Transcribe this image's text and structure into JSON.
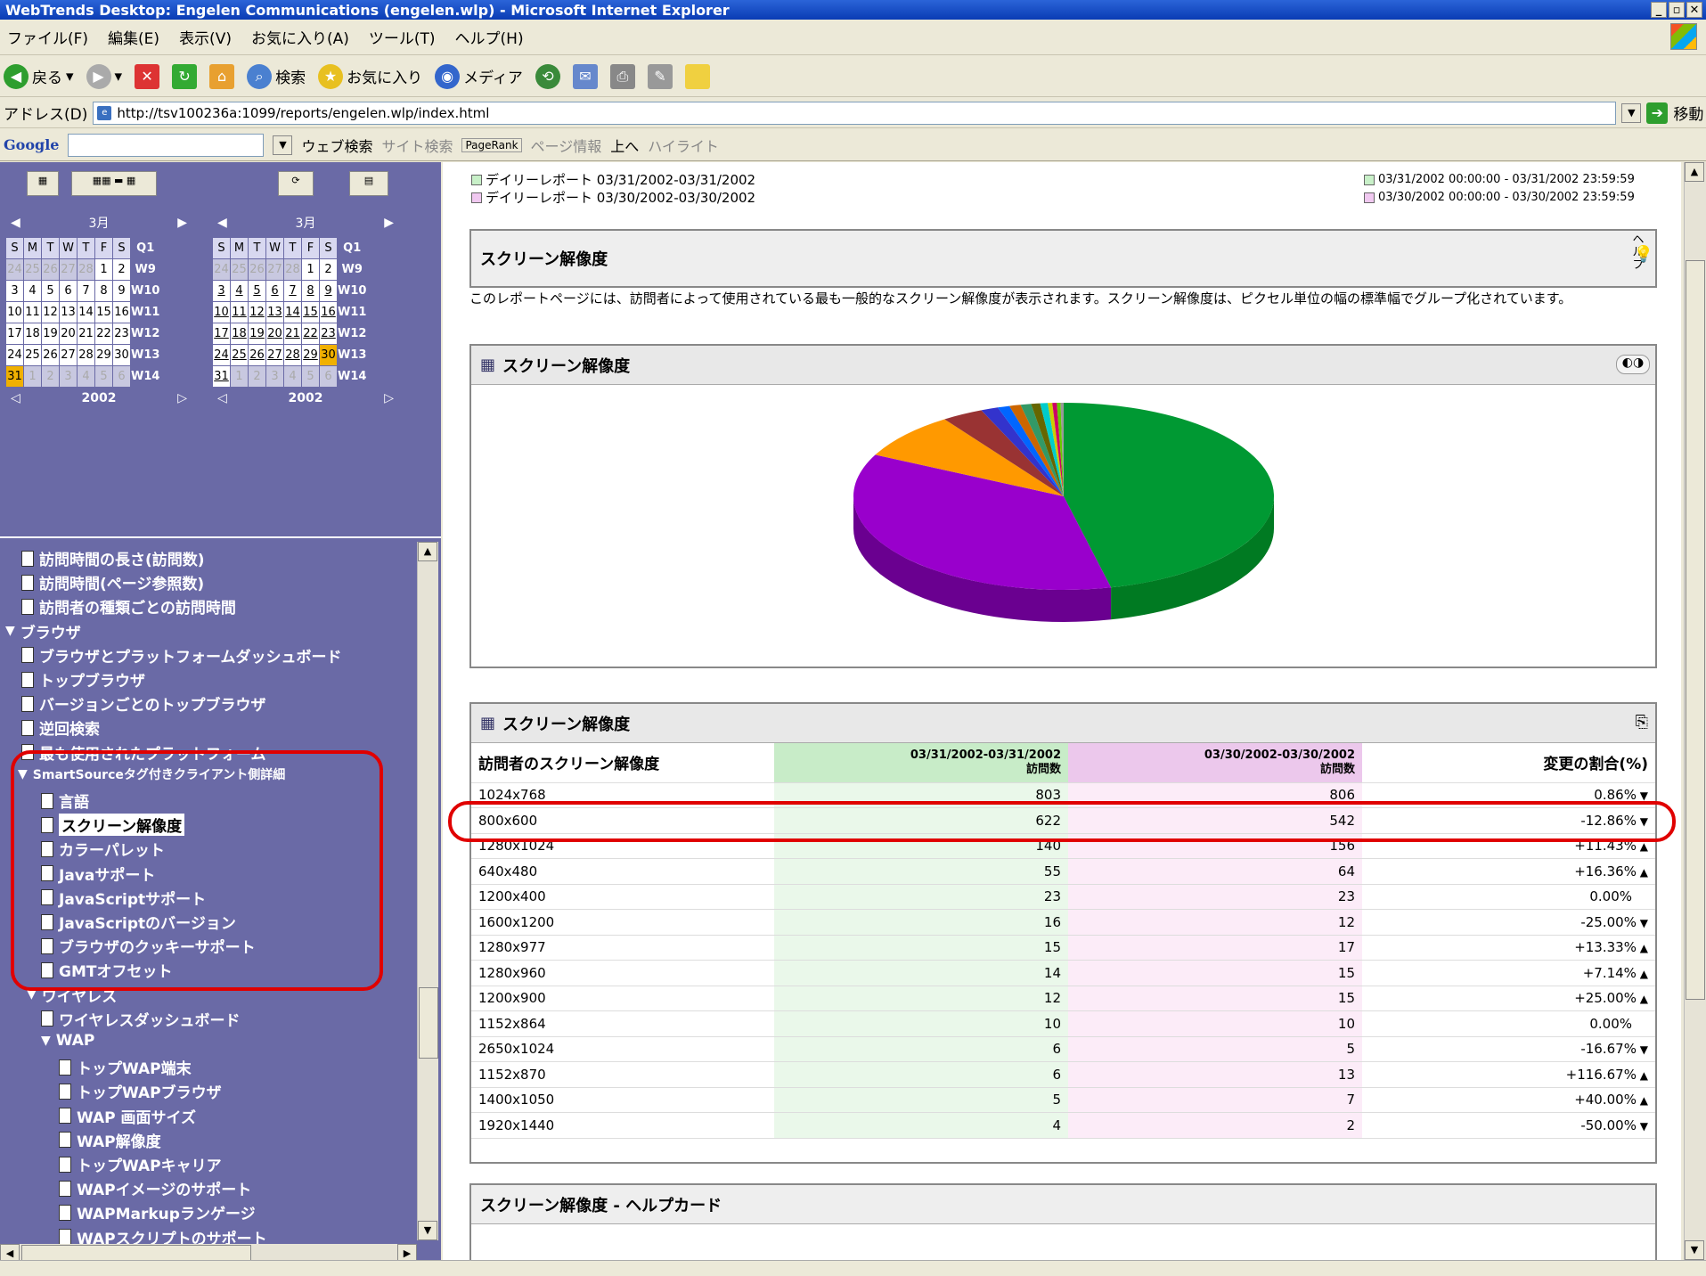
{
  "window": {
    "title": "WebTrends Desktop: Engelen Communications (engelen.wlp) - Microsoft Internet Explorer"
  },
  "menu": [
    "ファイル(F)",
    "編集(E)",
    "表示(V)",
    "お気に入り(A)",
    "ツール(T)",
    "ヘルプ(H)"
  ],
  "toolbar": {
    "back": "戻る",
    "search": "検索",
    "favorites": "お気に入り",
    "media": "メディア"
  },
  "address": {
    "label": "アドレス(D)",
    "url": "http://tsv100236a:1099/reports/engelen.wlp/index.html",
    "go": "移動"
  },
  "google": {
    "logo": "Google",
    "web_search": "ウェブ検索",
    "site_search": "サイト検索",
    "pagerank": "PageRank",
    "page_info": "ページ情報",
    "up": "上へ",
    "highlight": "ハイライト"
  },
  "calendar": {
    "month": "3月",
    "year": "2002",
    "day_headers": [
      "S",
      "M",
      "T",
      "W",
      "T",
      "F",
      "S"
    ],
    "left_weeks": [
      {
        "w": "Q1",
        "days": []
      },
      {
        "w": "W9",
        "days": [
          "24",
          "25",
          "26",
          "27",
          "28",
          "1",
          "2"
        ]
      },
      {
        "w": "W10",
        "days": [
          "3",
          "4",
          "5",
          "6",
          "7",
          "8",
          "9"
        ]
      },
      {
        "w": "W11",
        "days": [
          "10",
          "11",
          "12",
          "13",
          "14",
          "15",
          "16"
        ]
      },
      {
        "w": "W12",
        "days": [
          "17",
          "18",
          "19",
          "20",
          "21",
          "22",
          "23"
        ]
      },
      {
        "w": "W13",
        "days": [
          "24",
          "25",
          "26",
          "27",
          "28",
          "29",
          "30"
        ]
      },
      {
        "w": "W14",
        "days": [
          "31",
          "1",
          "2",
          "3",
          "4",
          "5",
          "6"
        ]
      }
    ]
  },
  "tree": {
    "items": [
      "訪問時間の長さ(訪問数)",
      "訪問時間(ページ参照数)",
      "訪問者の種類ごとの訪問時間",
      "ブラウザ",
      "ブラウザとプラットフォームダッシュボード",
      "トップブラウザ",
      "バージョンごとのトップブラウザ",
      "逆回検索",
      "最も使用されたプラットフォーム",
      "SmartSourceタグ付きクライアント側詳細",
      "言語",
      "スクリーン解像度",
      "カラーパレット",
      "Javaサポート",
      "JavaScriptサポート",
      "JavaScriptのバージョン",
      "ブラウザのクッキーサポート",
      "GMTオフセット",
      "ワイヤレス",
      "ワイヤレスダッシュボード",
      "WAP",
      "トップWAP端末",
      "トップWAPブラウザ",
      "WAP 画面サイズ",
      "WAP解像度",
      "トップWAPキャリア",
      "WAPイメージのサポート",
      "WAPMarkupランゲージ",
      "WAPスクリプトのサポート"
    ]
  },
  "legend": {
    "a_label": "デイリーレポート 03/31/2002-03/31/2002",
    "b_label": "デイリーレポート 03/30/2002-03/30/2002",
    "a_range": "03/31/2002 00:00:00 - 03/31/2002 23:59:59",
    "b_range": "03/30/2002 00:00:00 - 03/30/2002 23:59:59",
    "a_color": "#c8f0c8",
    "b_color": "#f0c8f0"
  },
  "report": {
    "title": "スクリーン解像度",
    "help": "ヘルプ",
    "description": "このレポートページには、訪問者によって使用されている最も一般的なスクリーン解像度が表示されます。スクリーン解像度は、ピクセル単位の幅の標準幅でグループ化されています。",
    "chart_title": "スクリーン解像度",
    "table_title": "スクリーン解像度",
    "helpcard_title": "スクリーン解像度 - ヘルプカード"
  },
  "table": {
    "headers": {
      "col1": "訪問者のスクリーン解像度",
      "col2_top": "03/31/2002-03/31/2002",
      "col2_bottom": "訪問数",
      "col3_top": "03/30/2002-03/30/2002",
      "col3_bottom": "訪問数",
      "col4": "変更の割合(%)"
    },
    "rows": [
      {
        "res": "1024x768",
        "a": "803",
        "b": "806",
        "chg": "0.86%",
        "dir": "down"
      },
      {
        "res": "800x600",
        "a": "622",
        "b": "542",
        "chg": "-12.86%",
        "dir": "down"
      },
      {
        "res": "1280x1024",
        "a": "140",
        "b": "156",
        "chg": "+11.43%",
        "dir": "up"
      },
      {
        "res": "640x480",
        "a": "55",
        "b": "64",
        "chg": "+16.36%",
        "dir": "up"
      },
      {
        "res": "1200x400",
        "a": "23",
        "b": "23",
        "chg": "0.00%",
        "dir": ""
      },
      {
        "res": "1600x1200",
        "a": "16",
        "b": "12",
        "chg": "-25.00%",
        "dir": "down"
      },
      {
        "res": "1280x977",
        "a": "15",
        "b": "17",
        "chg": "+13.33%",
        "dir": "up"
      },
      {
        "res": "1280x960",
        "a": "14",
        "b": "15",
        "chg": "+7.14%",
        "dir": "up"
      },
      {
        "res": "1200x900",
        "a": "12",
        "b": "15",
        "chg": "+25.00%",
        "dir": "up"
      },
      {
        "res": "1152x864",
        "a": "10",
        "b": "10",
        "chg": "0.00%",
        "dir": ""
      },
      {
        "res": "2650x1024",
        "a": "6",
        "b": "5",
        "chg": "-16.67%",
        "dir": "down"
      },
      {
        "res": "1152x870",
        "a": "6",
        "b": "13",
        "chg": "+116.67%",
        "dir": "up"
      },
      {
        "res": "1400x1050",
        "a": "5",
        "b": "7",
        "chg": "+40.00%",
        "dir": "up"
      },
      {
        "res": "1920x1440",
        "a": "4",
        "b": "2",
        "chg": "-50.00%",
        "dir": "down"
      }
    ]
  },
  "pie": {
    "slices": [
      {
        "value": 803,
        "color": "#009933",
        "side": "#007a22"
      },
      {
        "value": 622,
        "color": "#9900cc",
        "side": "#6a0090"
      },
      {
        "value": 140,
        "color": "#ff9900",
        "side": "#c07000"
      },
      {
        "value": 55,
        "color": "#993333",
        "side": "#6a2222"
      },
      {
        "value": 23,
        "color": "#3333cc",
        "side": "#222299"
      },
      {
        "value": 16,
        "color": "#0066ff",
        "side": "#0044bb"
      },
      {
        "value": 15,
        "color": "#cc6600",
        "side": "#884400"
      },
      {
        "value": 14,
        "color": "#339966",
        "side": "#226644"
      },
      {
        "value": 12,
        "color": "#666600",
        "side": "#444400"
      },
      {
        "value": 10,
        "color": "#00cccc",
        "side": "#009999"
      },
      {
        "value": 6,
        "color": "#cccc00",
        "side": "#999900"
      },
      {
        "value": 6,
        "color": "#cc0066",
        "side": "#990044"
      },
      {
        "value": 5,
        "color": "#66cc00",
        "side": "#449900"
      },
      {
        "value": 4,
        "color": "#999999",
        "side": "#666666"
      }
    ]
  }
}
